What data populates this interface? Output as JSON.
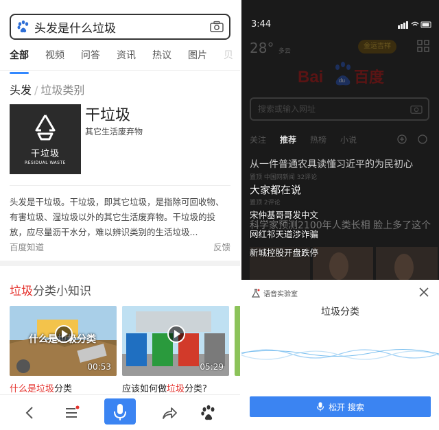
{
  "left": {
    "search": {
      "query": "头发是什么垃圾"
    },
    "tabs": [
      "全部",
      "视频",
      "问答",
      "资讯",
      "热议",
      "图片",
      "贝"
    ],
    "breadcrumb": {
      "main": "头发",
      "sep": "/",
      "sub": "垃圾类别"
    },
    "category": {
      "card_text": "干垃圾",
      "card_subtext": "RESIDUAL WASTE",
      "title": "干垃圾",
      "description": "其它生活废弃物"
    },
    "paragraph": "头发是干垃圾。干垃圾，即其它垃圾，是指除可回收物、有害垃圾、湿垃圾以外的其它生活废弃物。干垃圾的投放，应尽量沥干水分，难以辨识类别的生活垃圾...",
    "source": "百度知道",
    "feedback": "反馈",
    "knowledge": {
      "title_red": "垃圾",
      "title_rest": "分类小知识"
    },
    "videos": [
      {
        "duration": "00:53",
        "overlay_text": "什么是垃圾分类",
        "caption_pre": "",
        "caption_red": "什么是垃圾",
        "caption_post": "分类"
      },
      {
        "duration": "05:29",
        "caption_pre": "应该如何做",
        "caption_red": "垃圾",
        "caption_post": "分类?"
      }
    ],
    "colors": {
      "accent": "#3b84f2",
      "red": "#e5322d"
    }
  },
  "right": {
    "status_time": "3:44",
    "weather": {
      "temp": "28°",
      "desc": "多云"
    },
    "pill_text": "金运吉祥",
    "logo_text": "Bai du 百度",
    "search_placeholder": "搜索或输入网址",
    "tabs": [
      "关注",
      "推荐",
      "热榜",
      "小说"
    ],
    "news": [
      {
        "title": "从一件普通农具读懂习近平的为民初心",
        "meta": "置顶 中国网新闻 32评论"
      },
      {
        "title": "大家都在说 的初心",
        "meta": "置顶 2评论"
      },
      {
        "title": "科学家预测2100年人类长相 脸上多了这个"
      }
    ],
    "hot": {
      "title": "大家都在说",
      "items": [
        "宋仲基哥哥发中文",
        "网红祁天道涉诈骗",
        "新城控股开盘跌停"
      ]
    },
    "voice": {
      "label": "语音实验室",
      "query": "垃圾分类",
      "button": "松开 搜索"
    }
  }
}
